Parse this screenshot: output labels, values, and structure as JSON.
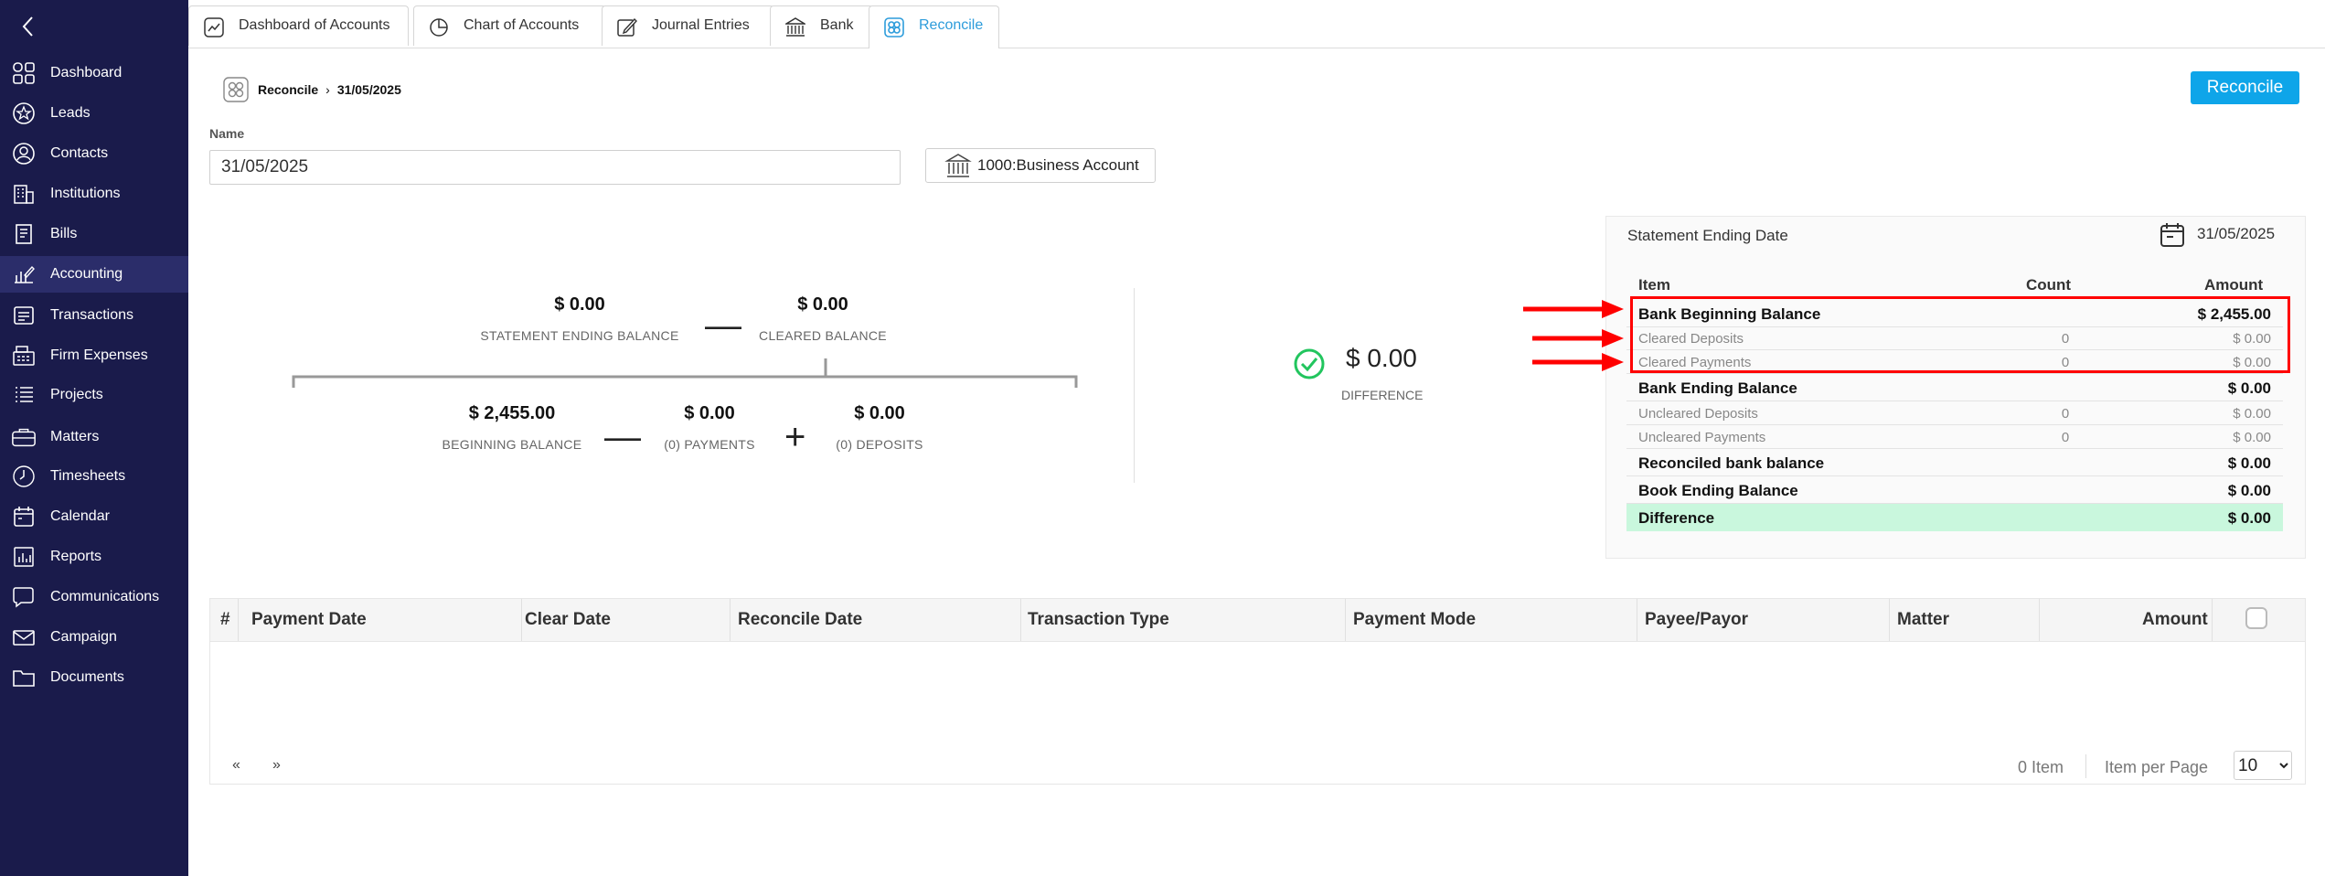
{
  "sidebar": {
    "items": [
      {
        "label": "Dashboard",
        "icon": "grid-icon"
      },
      {
        "label": "Leads",
        "icon": "star-circle-icon"
      },
      {
        "label": "Contacts",
        "icon": "person-circle-icon"
      },
      {
        "label": "Institutions",
        "icon": "building-icon"
      },
      {
        "label": "Bills",
        "icon": "bill-icon"
      },
      {
        "label": "Accounting",
        "icon": "chart-pencil-icon"
      },
      {
        "label": "Transactions",
        "icon": "transactions-icon"
      },
      {
        "label": "Firm Expenses",
        "icon": "register-icon"
      },
      {
        "label": "Projects",
        "icon": "list-icon"
      },
      {
        "label": "Matters",
        "icon": "briefcase-icon"
      },
      {
        "label": "Timesheets",
        "icon": "clock-icon"
      },
      {
        "label": "Calendar",
        "icon": "calendar-icon"
      },
      {
        "label": "Reports",
        "icon": "report-icon"
      },
      {
        "label": "Communications",
        "icon": "chat-icon"
      },
      {
        "label": "Campaign",
        "icon": "mail-icon"
      },
      {
        "label": "Documents",
        "icon": "folder-icon"
      }
    ],
    "active": "Accounting"
  },
  "tabs": [
    {
      "label": "Dashboard of Accounts",
      "icon": "trend-icon"
    },
    {
      "label": "Chart of Accounts",
      "icon": "pie-icon"
    },
    {
      "label": "Journal Entries",
      "icon": "edit-icon"
    },
    {
      "label": "Bank",
      "icon": "bank-icon"
    },
    {
      "label": "Reconcile",
      "icon": "reconcile-icon"
    }
  ],
  "breadcrumb": {
    "root": "Reconcile",
    "current": "31/05/2025"
  },
  "reconcile_button": "Reconcile",
  "form": {
    "name_label": "Name",
    "name_value": "31/05/2025",
    "account": "1000:Business Account"
  },
  "summary": {
    "statement_ending_balance": "$ 0.00",
    "statement_ending_caption": "STATEMENT ENDING BALANCE",
    "cleared_balance": "$ 0.00",
    "cleared_caption": "CLEARED BALANCE",
    "beginning_balance": "$ 2,455.00",
    "beginning_caption": "BEGINNING BALANCE",
    "payments": "$ 0.00",
    "payments_caption": "(0) PAYMENTS",
    "deposits": "$ 0.00",
    "deposits_caption": "(0) DEPOSITS",
    "difference": "$ 0.00",
    "difference_caption": "DIFFERENCE"
  },
  "panel": {
    "title": "Statement Ending Date",
    "date": "31/05/2025",
    "headers": {
      "item": "Item",
      "count": "Count",
      "amount": "Amount"
    },
    "rows": [
      {
        "item": "Bank Beginning Balance",
        "count": "",
        "amount": "$ 2,455.00",
        "style": "bold"
      },
      {
        "item": "Cleared Deposits",
        "count": "0",
        "amount": "$ 0.00",
        "style": "sub"
      },
      {
        "item": "Cleared Payments",
        "count": "0",
        "amount": "$ 0.00",
        "style": "sub"
      },
      {
        "item": "Bank Ending Balance",
        "count": "",
        "amount": "$ 0.00",
        "style": "bold"
      },
      {
        "item": "Uncleared Deposits",
        "count": "0",
        "amount": "$ 0.00",
        "style": "sub"
      },
      {
        "item": "Uncleared Payments",
        "count": "0",
        "amount": "$ 0.00",
        "style": "sub"
      },
      {
        "item": "Reconciled bank balance",
        "count": "",
        "amount": "$ 0.00",
        "style": "bold"
      },
      {
        "item": "Book Ending Balance",
        "count": "",
        "amount": "$ 0.00",
        "style": "bold"
      },
      {
        "item": "Difference",
        "count": "",
        "amount": "$ 0.00",
        "style": "green"
      }
    ]
  },
  "table": {
    "columns": [
      "#",
      "Payment Date",
      "Clear Date",
      "Reconcile Date",
      "Transaction Type",
      "Payment Mode",
      "Payee/Payor",
      "Matter",
      "Amount"
    ],
    "prev": "«",
    "next": "»",
    "item_count": "0 Item",
    "per_page_label": "Item per Page",
    "per_page": "10"
  },
  "colors": {
    "sidebar_bg": "#1a1b4b",
    "accent": "#0ea5e9",
    "difference_bg": "#c9f7dd",
    "highlight": "#ff0000"
  }
}
